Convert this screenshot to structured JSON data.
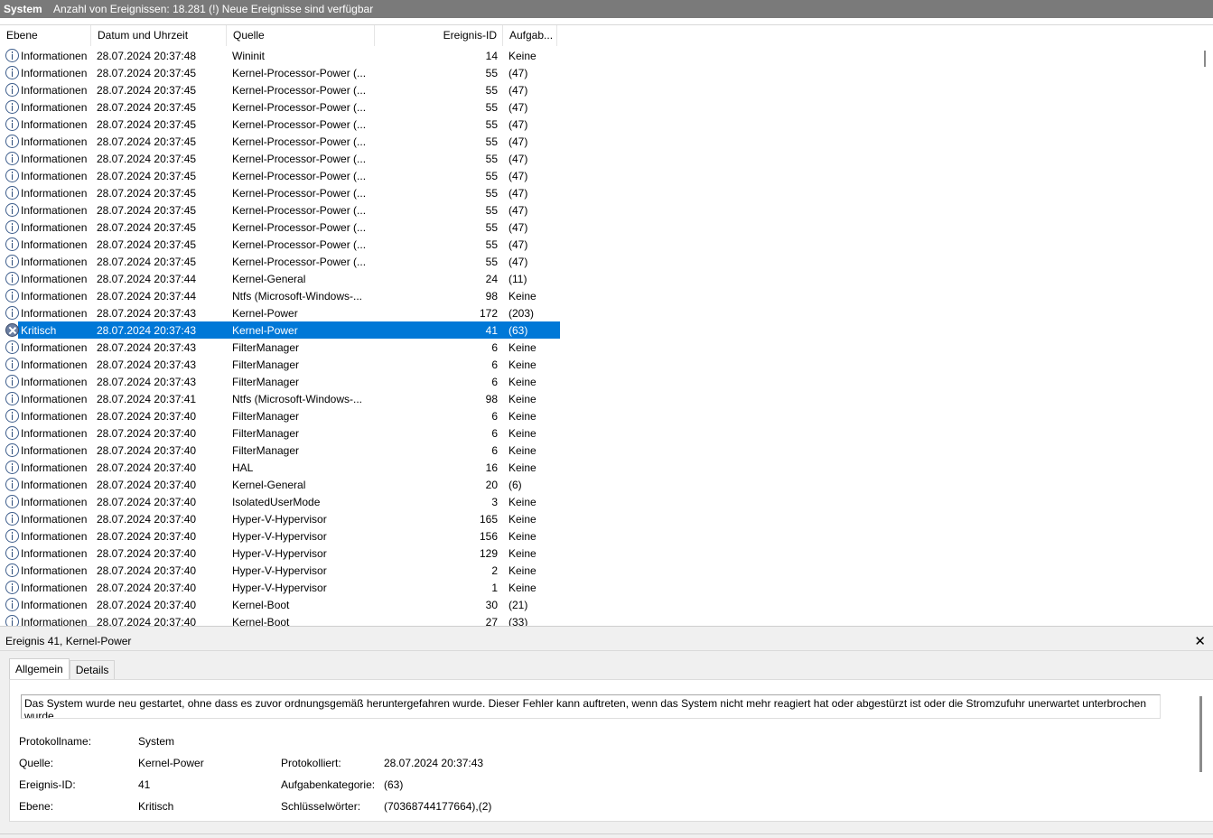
{
  "title_bar": {
    "log_name": "System",
    "event_count_text": "Anzahl von Ereignissen: 18.281 (!) Neue Ereignisse sind verfügbar"
  },
  "columns": {
    "level": "Ebene",
    "date": "Datum und Uhrzeit",
    "source": "Quelle",
    "event_id": "Ereignis-ID",
    "task": "Aufgab..."
  },
  "rows": [
    {
      "level": "Informationen",
      "date": "28.07.2024 20:37:48",
      "source": "Wininit",
      "id": "14",
      "task": "Keine",
      "type": "info"
    },
    {
      "level": "Informationen",
      "date": "28.07.2024 20:37:45",
      "source": "Kernel-Processor-Power (...",
      "id": "55",
      "task": "(47)",
      "type": "info"
    },
    {
      "level": "Informationen",
      "date": "28.07.2024 20:37:45",
      "source": "Kernel-Processor-Power (...",
      "id": "55",
      "task": "(47)",
      "type": "info"
    },
    {
      "level": "Informationen",
      "date": "28.07.2024 20:37:45",
      "source": "Kernel-Processor-Power (...",
      "id": "55",
      "task": "(47)",
      "type": "info"
    },
    {
      "level": "Informationen",
      "date": "28.07.2024 20:37:45",
      "source": "Kernel-Processor-Power (...",
      "id": "55",
      "task": "(47)",
      "type": "info"
    },
    {
      "level": "Informationen",
      "date": "28.07.2024 20:37:45",
      "source": "Kernel-Processor-Power (...",
      "id": "55",
      "task": "(47)",
      "type": "info"
    },
    {
      "level": "Informationen",
      "date": "28.07.2024 20:37:45",
      "source": "Kernel-Processor-Power (...",
      "id": "55",
      "task": "(47)",
      "type": "info"
    },
    {
      "level": "Informationen",
      "date": "28.07.2024 20:37:45",
      "source": "Kernel-Processor-Power (...",
      "id": "55",
      "task": "(47)",
      "type": "info"
    },
    {
      "level": "Informationen",
      "date": "28.07.2024 20:37:45",
      "source": "Kernel-Processor-Power (...",
      "id": "55",
      "task": "(47)",
      "type": "info"
    },
    {
      "level": "Informationen",
      "date": "28.07.2024 20:37:45",
      "source": "Kernel-Processor-Power (...",
      "id": "55",
      "task": "(47)",
      "type": "info"
    },
    {
      "level": "Informationen",
      "date": "28.07.2024 20:37:45",
      "source": "Kernel-Processor-Power (...",
      "id": "55",
      "task": "(47)",
      "type": "info"
    },
    {
      "level": "Informationen",
      "date": "28.07.2024 20:37:45",
      "source": "Kernel-Processor-Power (...",
      "id": "55",
      "task": "(47)",
      "type": "info"
    },
    {
      "level": "Informationen",
      "date": "28.07.2024 20:37:45",
      "source": "Kernel-Processor-Power (...",
      "id": "55",
      "task": "(47)",
      "type": "info"
    },
    {
      "level": "Informationen",
      "date": "28.07.2024 20:37:44",
      "source": "Kernel-General",
      "id": "24",
      "task": "(11)",
      "type": "info"
    },
    {
      "level": "Informationen",
      "date": "28.07.2024 20:37:44",
      "source": "Ntfs (Microsoft-Windows-...",
      "id": "98",
      "task": "Keine",
      "type": "info"
    },
    {
      "level": "Informationen",
      "date": "28.07.2024 20:37:43",
      "source": "Kernel-Power",
      "id": "172",
      "task": "(203)",
      "type": "info"
    },
    {
      "level": "Kritisch",
      "date": "28.07.2024 20:37:43",
      "source": "Kernel-Power",
      "id": "41",
      "task": "(63)",
      "type": "critical"
    },
    {
      "level": "Informationen",
      "date": "28.07.2024 20:37:43",
      "source": "FilterManager",
      "id": "6",
      "task": "Keine",
      "type": "info"
    },
    {
      "level": "Informationen",
      "date": "28.07.2024 20:37:43",
      "source": "FilterManager",
      "id": "6",
      "task": "Keine",
      "type": "info"
    },
    {
      "level": "Informationen",
      "date": "28.07.2024 20:37:43",
      "source": "FilterManager",
      "id": "6",
      "task": "Keine",
      "type": "info"
    },
    {
      "level": "Informationen",
      "date": "28.07.2024 20:37:41",
      "source": "Ntfs (Microsoft-Windows-...",
      "id": "98",
      "task": "Keine",
      "type": "info"
    },
    {
      "level": "Informationen",
      "date": "28.07.2024 20:37:40",
      "source": "FilterManager",
      "id": "6",
      "task": "Keine",
      "type": "info"
    },
    {
      "level": "Informationen",
      "date": "28.07.2024 20:37:40",
      "source": "FilterManager",
      "id": "6",
      "task": "Keine",
      "type": "info"
    },
    {
      "level": "Informationen",
      "date": "28.07.2024 20:37:40",
      "source": "FilterManager",
      "id": "6",
      "task": "Keine",
      "type": "info"
    },
    {
      "level": "Informationen",
      "date": "28.07.2024 20:37:40",
      "source": "HAL",
      "id": "16",
      "task": "Keine",
      "type": "info"
    },
    {
      "level": "Informationen",
      "date": "28.07.2024 20:37:40",
      "source": "Kernel-General",
      "id": "20",
      "task": "(6)",
      "type": "info"
    },
    {
      "level": "Informationen",
      "date": "28.07.2024 20:37:40",
      "source": "IsolatedUserMode",
      "id": "3",
      "task": "Keine",
      "type": "info"
    },
    {
      "level": "Informationen",
      "date": "28.07.2024 20:37:40",
      "source": "Hyper-V-Hypervisor",
      "id": "165",
      "task": "Keine",
      "type": "info"
    },
    {
      "level": "Informationen",
      "date": "28.07.2024 20:37:40",
      "source": "Hyper-V-Hypervisor",
      "id": "156",
      "task": "Keine",
      "type": "info"
    },
    {
      "level": "Informationen",
      "date": "28.07.2024 20:37:40",
      "source": "Hyper-V-Hypervisor",
      "id": "129",
      "task": "Keine",
      "type": "info"
    },
    {
      "level": "Informationen",
      "date": "28.07.2024 20:37:40",
      "source": "Hyper-V-Hypervisor",
      "id": "2",
      "task": "Keine",
      "type": "info"
    },
    {
      "level": "Informationen",
      "date": "28.07.2024 20:37:40",
      "source": "Hyper-V-Hypervisor",
      "id": "1",
      "task": "Keine",
      "type": "info"
    },
    {
      "level": "Informationen",
      "date": "28.07.2024 20:37:40",
      "source": "Kernel-Boot",
      "id": "30",
      "task": "(21)",
      "type": "info"
    },
    {
      "level": "Informationen",
      "date": "28.07.2024 20:37:40",
      "source": "Kernel-Boot",
      "id": "27",
      "task": "(33)",
      "type": "info"
    }
  ],
  "selected_index": 16,
  "detail": {
    "header": "Ereignis 41, Kernel-Power",
    "close_glyph": "✕",
    "tabs": [
      "Allgemein",
      "Details"
    ],
    "description": "Das System wurde neu gestartet, ohne dass es zuvor ordnungsgemäß heruntergefahren wurde. Dieser Fehler kann auftreten, wenn das System nicht mehr reagiert hat oder abgestürzt ist oder die Stromzufuhr unerwartet unterbrochen wurde.",
    "fields": {
      "log_name_label": "Protokollname:",
      "log_name_value": "System",
      "source_label": "Quelle:",
      "source_value": "Kernel-Power",
      "logged_label": "Protokolliert:",
      "logged_value": "28.07.2024 20:37:43",
      "event_id_label": "Ereignis-ID:",
      "event_id_value": "41",
      "task_label": "Aufgabenkategorie:",
      "task_value": "(63)",
      "level_label": "Ebene:",
      "level_value": "Kritisch",
      "keywords_label": "Schlüsselwörter:",
      "keywords_value": "(70368744177664),(2)"
    }
  },
  "colors": {
    "selection": "#0078d7",
    "titlebar": "#7a7a7a"
  }
}
